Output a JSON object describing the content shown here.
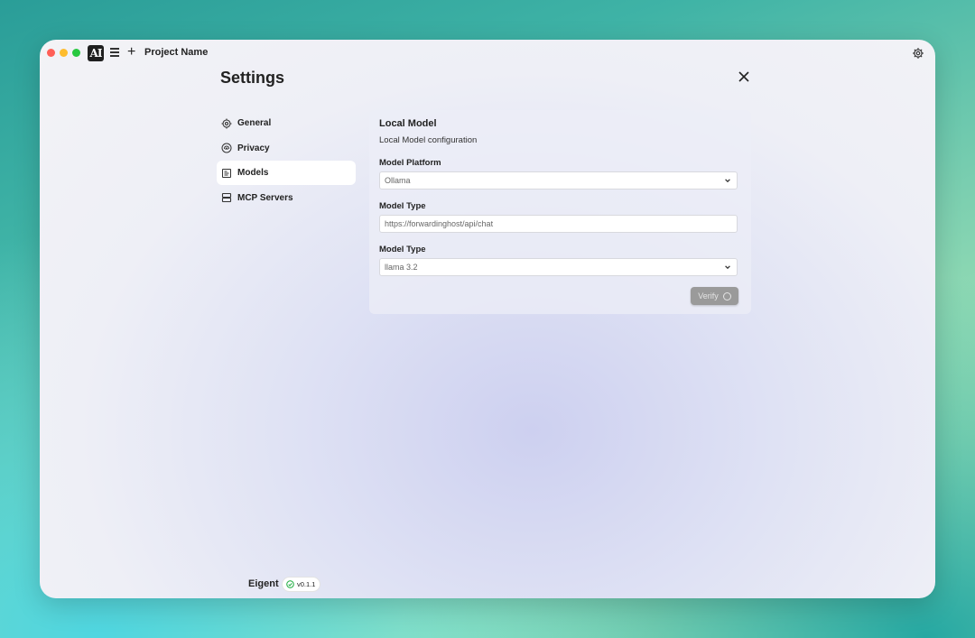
{
  "app": {
    "logo_text": "AI",
    "project_name": "Project Name"
  },
  "settings": {
    "title": "Settings",
    "nav": [
      {
        "label": "General",
        "icon": "gear-icon"
      },
      {
        "label": "Privacy",
        "icon": "fingerprint-icon"
      },
      {
        "label": "Models",
        "icon": "document-icon",
        "active": true
      },
      {
        "label": "MCP Servers",
        "icon": "server-icon"
      }
    ]
  },
  "panel": {
    "title": "Local Model",
    "subtitle": "Local Model configuration",
    "platform_label": "Model Platform",
    "platform_value": "Ollama",
    "type_label_1": "Model Type",
    "type_value_1": "https://forwardinghost/api/chat",
    "type_label_2": "Model Type",
    "type_value_2": "llama 3.2",
    "verify_label": "Verify"
  },
  "footer": {
    "brand": "Eigent",
    "version": "v0.1.1"
  },
  "colors": {
    "traffic_red": "#ff5f57",
    "traffic_yellow": "#febc2e",
    "traffic_green": "#28c840",
    "verify_disabled": "#9a9a9a",
    "version_check": "#2bb24c"
  }
}
